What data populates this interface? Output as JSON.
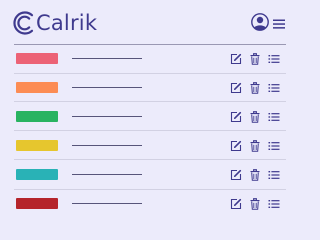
{
  "app": {
    "logo_text": "Calrik",
    "brand_color": "#3f3a8e"
  },
  "header": {
    "icons": [
      "logo-c-icon",
      "user-avatar-icon",
      "hamburger-menu-icon"
    ]
  },
  "rows": [
    {
      "color": "#ec6276",
      "actions": [
        "edit-icon",
        "trash-icon",
        "list-icon"
      ]
    },
    {
      "color": "#fc8c54",
      "actions": [
        "edit-icon",
        "trash-icon",
        "list-icon"
      ]
    },
    {
      "color": "#29b361",
      "actions": [
        "edit-icon",
        "trash-icon",
        "list-icon"
      ]
    },
    {
      "color": "#e6c62e",
      "actions": [
        "edit-icon",
        "trash-icon",
        "list-icon"
      ]
    },
    {
      "color": "#29b2b6",
      "actions": [
        "edit-icon",
        "trash-icon",
        "list-icon"
      ]
    },
    {
      "color": "#b5242b",
      "actions": [
        "edit-icon",
        "trash-icon",
        "list-icon"
      ]
    }
  ]
}
